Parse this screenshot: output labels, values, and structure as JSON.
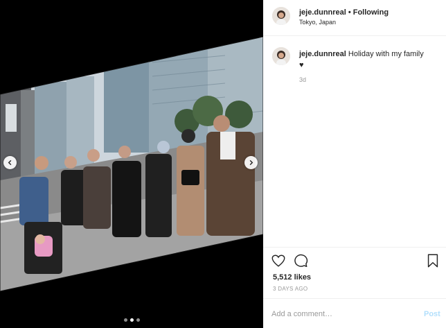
{
  "post": {
    "username": "jeje.dunnreal",
    "separator": "•",
    "follow_status": "Following",
    "location": "Tokyo, Japan",
    "caption": "Holiday with my family",
    "caption_heart": "♥",
    "caption_time": "3d",
    "likes": "5,512 likes",
    "posted_ago": "3 DAYS AGO"
  },
  "comment": {
    "placeholder": "Add a comment…",
    "post_label": "Post"
  },
  "carousel": {
    "slide_count": 3,
    "active_index": 1
  },
  "colors": {
    "link_blue_disabled": "#b2dffc",
    "text": "#262626",
    "muted": "#999999",
    "divider": "#efefef"
  },
  "icons": [
    "heart-icon",
    "comment-icon",
    "bookmark-icon",
    "chevron-left-icon",
    "chevron-right-icon"
  ]
}
